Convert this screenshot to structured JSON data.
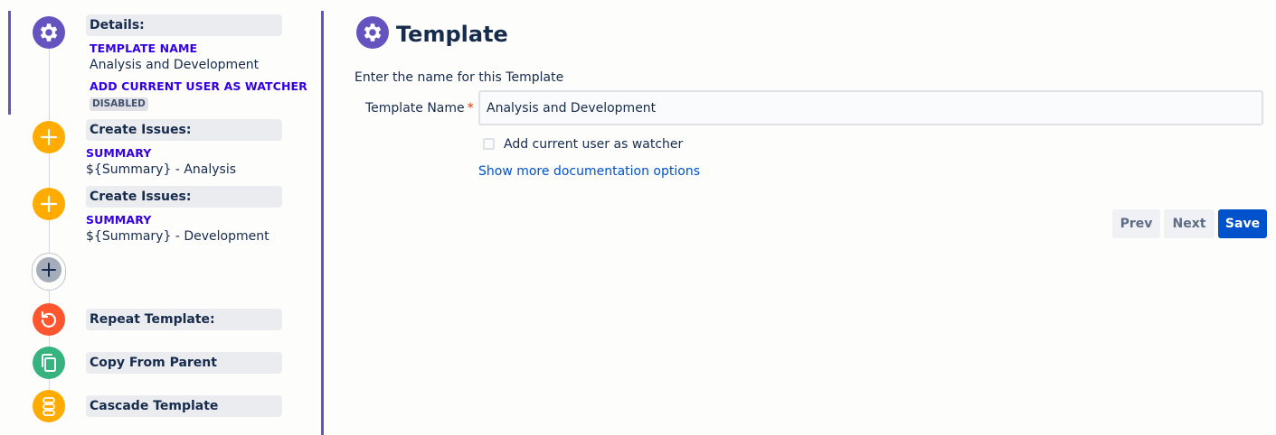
{
  "sidebar": {
    "steps": [
      {
        "header": "Details:",
        "fields": [
          {
            "label": "TEMPLATE NAME",
            "value": "Analysis and Development"
          },
          {
            "label": "ADD CURRENT USER AS WATCHER",
            "badge": "DISABLED"
          }
        ],
        "icon": "gear-icon",
        "color": "#6554c0"
      },
      {
        "header": "Create Issues:",
        "fields": [
          {
            "label": "SUMMARY",
            "value": "${Summary} - Analysis"
          }
        ],
        "icon": "plus-icon",
        "color": "#ffab00"
      },
      {
        "header": "Create Issues:",
        "fields": [
          {
            "label": "SUMMARY",
            "value": "${Summary} - Development"
          }
        ],
        "icon": "plus-icon",
        "color": "#ffab00"
      },
      {
        "header": "Repeat Template:",
        "icon": "repeat-icon",
        "color": "#ff5630"
      },
      {
        "header": "Copy From Parent",
        "icon": "copy-icon",
        "color": "#36b37e"
      },
      {
        "header": "Cascade Template",
        "icon": "cascade-icon",
        "color": "#ffab00"
      }
    ],
    "add_step_icon": "plus-icon"
  },
  "main": {
    "title": "Template",
    "title_icon": "gear-icon",
    "instruction": "Enter the name for this Template",
    "form": {
      "template_name_label": "Template Name",
      "required_marker": "*",
      "template_name_value": "Analysis and Development",
      "watcher_checkbox_label": "Add current user as watcher",
      "watcher_checked": false,
      "more_docs_link": "Show more documentation options"
    },
    "buttons": {
      "prev": "Prev",
      "next": "Next",
      "save": "Save"
    }
  },
  "colors": {
    "accent": "#6554c0",
    "primary": "#0052cc",
    "field_label": "#3300e6",
    "required": "#de350b"
  }
}
